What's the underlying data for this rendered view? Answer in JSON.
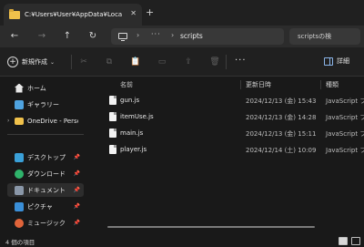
{
  "window": {
    "tab_title": "C:¥Users¥User¥AppData¥Loca",
    "tab_close": "✕",
    "tab_add": "+"
  },
  "nav": {
    "back": "←",
    "forward": "→",
    "up": "↑",
    "refresh": "↻",
    "path_sep": "›",
    "overflow": "···",
    "current_folder": "scripts",
    "search_placeholder": "scriptsの検"
  },
  "commands": {
    "new_label": "新規作成",
    "new_chevron": "⌄",
    "more": "···",
    "details_label": "詳細"
  },
  "sidebar": {
    "items": [
      {
        "label": "ホーム",
        "icon": "home-icon",
        "color": "#e8e8e8",
        "pinned": false
      },
      {
        "label": "ギャラリー",
        "icon": "gallery-icon",
        "color": "#4fa3e0",
        "pinned": false
      },
      {
        "label": "OneDrive - Perso",
        "icon": "onedrive-folder-icon",
        "color": "#f0c14b",
        "pinned": false
      },
      {
        "label": "デスクトップ",
        "icon": "desktop-icon",
        "color": "#3aa0d8",
        "pinned": true
      },
      {
        "label": "ダウンロード",
        "icon": "download-icon",
        "color": "#2fb36b",
        "pinned": true
      },
      {
        "label": "ドキュメント",
        "icon": "documents-icon",
        "color": "#8a97a8",
        "pinned": true
      },
      {
        "label": "ピクチャ",
        "icon": "pictures-icon",
        "color": "#3a8fd8",
        "pinned": true
      },
      {
        "label": "ミュージック",
        "icon": "music-icon",
        "color": "#e0643a",
        "pinned": true
      }
    ],
    "chevron": "›",
    "pin_glyph": "📌"
  },
  "table": {
    "columns": [
      "名前",
      "更新日時",
      "種類"
    ],
    "rows": [
      {
        "name": "gun.js",
        "date": "2024/12/13 (金) 15:43",
        "type": "JavaScript ファイ"
      },
      {
        "name": "itemUse.js",
        "date": "2024/12/13 (金) 14:28",
        "type": "JavaScript ファイ"
      },
      {
        "name": "main.js",
        "date": "2024/12/13 (金) 15:11",
        "type": "JavaScript ファイ"
      },
      {
        "name": "player.js",
        "date": "2024/12/14 (土) 10:09",
        "type": "JavaScript ファイ"
      }
    ]
  },
  "status": {
    "item_count": "4 個の項目"
  }
}
